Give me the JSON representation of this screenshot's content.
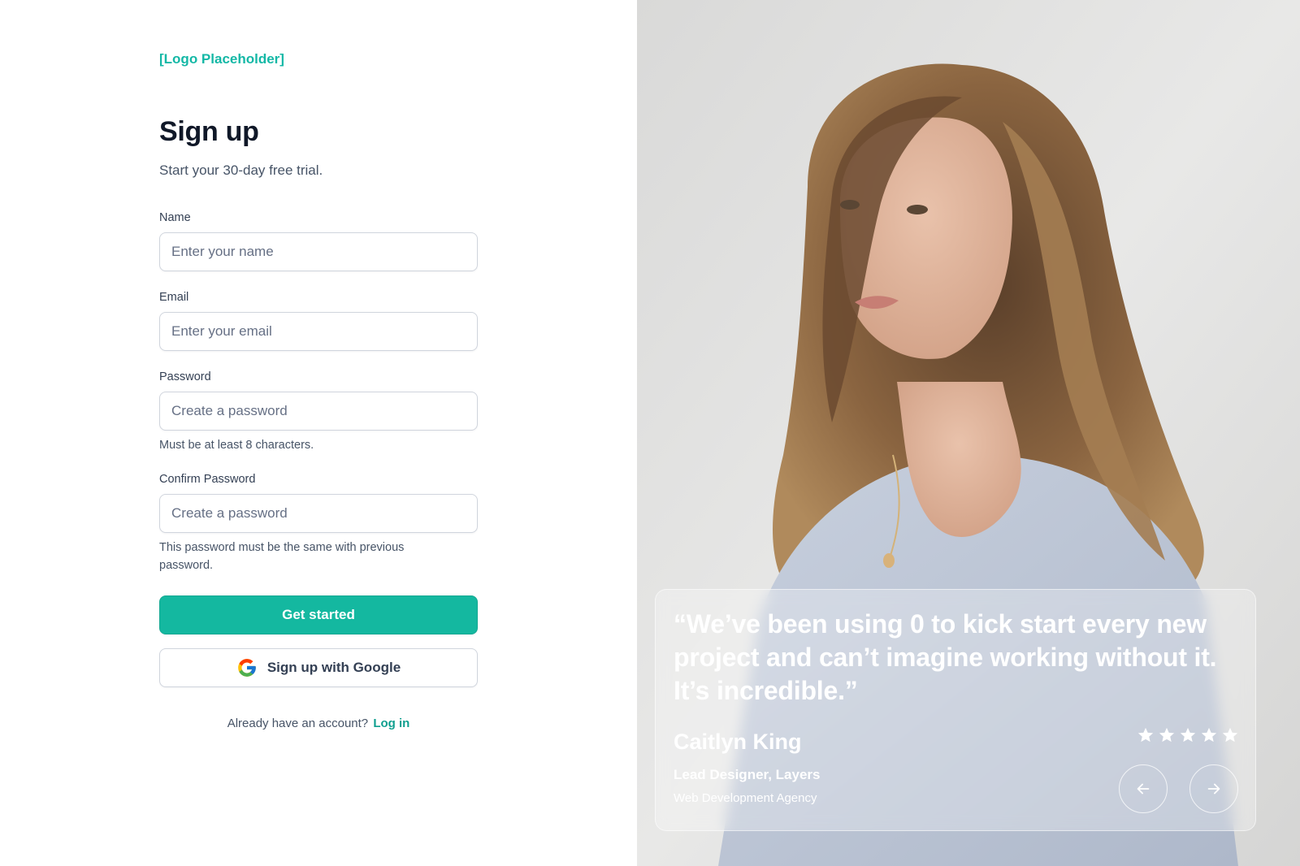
{
  "logo": "[Logo Placeholder]",
  "form": {
    "title": "Sign up",
    "subtitle": "Start your 30-day free trial.",
    "name": {
      "label": "Name",
      "placeholder": "Enter your name",
      "value": ""
    },
    "email": {
      "label": "Email",
      "placeholder": "Enter your email",
      "value": ""
    },
    "password": {
      "label": "Password",
      "placeholder": "Create a password",
      "value": "",
      "hint": "Must be at least 8 characters."
    },
    "confirm_password": {
      "label": "Confirm Password",
      "placeholder": "Create a password",
      "value": "",
      "hint": "This password must be the same with previous password."
    },
    "submit_label": "Get started",
    "google_label": "Sign up with Google",
    "footer_text": "Already have an account?",
    "login_link": "Log in"
  },
  "testimonial": {
    "quote": "“We’ve been using 0 to kick start every new project and can’t imagine working without it. It’s incredible.”",
    "author": "Caitlyn King",
    "role": "Lead Designer, Layers",
    "company": "Web Development Agency",
    "rating": 5
  },
  "colors": {
    "accent": "#14b8a0",
    "text_primary": "#101828",
    "text_secondary": "#475467",
    "border": "#d0d5dd"
  },
  "icons": {
    "google": "google-icon",
    "star": "star-icon",
    "prev": "arrow-left-icon",
    "next": "arrow-right-icon"
  }
}
